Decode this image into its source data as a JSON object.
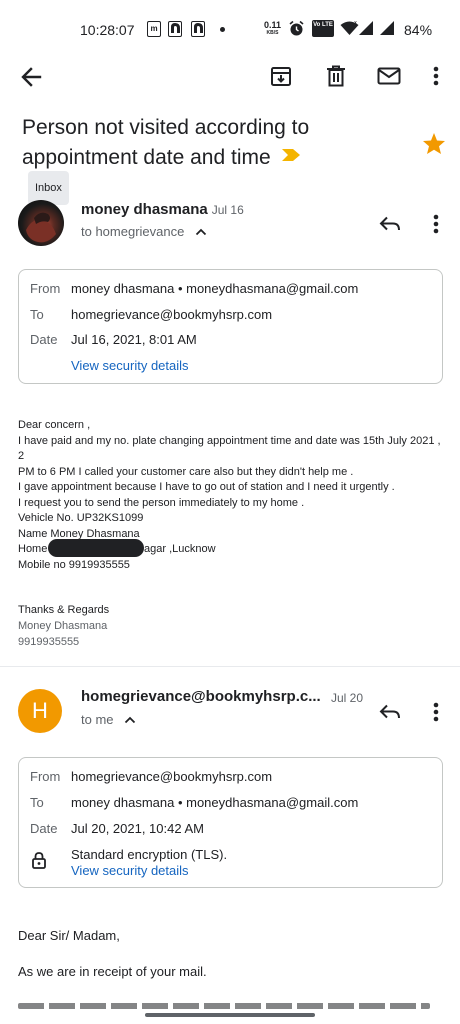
{
  "status_bar": {
    "time": "10:28:07",
    "speed_value": "0.11",
    "speed_unit": "KB/S",
    "volte_label": "Vo LTE",
    "battery": "84%",
    "notification_icons": [
      "m-icon",
      "app-icon",
      "app-icon",
      "dot-icon"
    ]
  },
  "toolbar": {
    "back_icon": "back-arrow-icon",
    "archive_icon": "archive-icon",
    "delete_icon": "trash-icon",
    "mark_unread_icon": "mail-icon",
    "more_icon": "more-vert-icon"
  },
  "subject": {
    "title": "Person not visited according to appointment date and time",
    "label": "Inbox",
    "starred": true,
    "star_color": "#f29900",
    "importance_color": "#f4b400"
  },
  "message1": {
    "sender": "money dhasmana",
    "date": "Jul 16",
    "to_line": "to homegrievance",
    "details": {
      "from_label": "From",
      "from_value": "money dhasmana • moneydhasmana@gmail.com",
      "to_label": "To",
      "to_value": "homegrievance@bookmyhsrp.com",
      "date_label": "Date",
      "date_value": "Jul 16, 2021, 8:01 AM",
      "security_link": "View security details"
    },
    "body": [
      "Dear concern ,",
      "I have paid and my no. plate changing appointment time and date was 15th July 2021 , 2",
      "PM to 6 PM I called your customer care also but they didn't help me .",
      "I gave appointment because I have to go out of station and I need it urgently .",
      "I request you to send the person immediately to my home ."
    ],
    "vehicle": "Vehicle No. UP32KS1099",
    "name": "Name Money Dhasmana",
    "home_prefix": "Home",
    "home_suffix": "agar ,Lucknow",
    "mobile": "Mobile no 9919935555",
    "thanks": "Thanks & Regards",
    "sig_name": "Money Dhasmana",
    "sig_phone": "9919935555"
  },
  "message2": {
    "avatar_letter": "H",
    "avatar_color": "#f29900",
    "sender": "homegrievance@bookmyhsrp.c...",
    "date": "Jul 20",
    "to_line": "to me",
    "details": {
      "from_label": "From",
      "from_value": "homegrievance@bookmyhsrp.com",
      "to_label": "To",
      "to_value": "money dhasmana • moneydhasmana@gmail.com",
      "date_label": "Date",
      "date_value": "Jul 20, 2021, 10:42 AM",
      "encryption": "Standard encryption (TLS).",
      "security_link": "View security details"
    },
    "body_greeting": "Dear Sir/ Madam,",
    "body_line1": "As we are in receipt of your mail."
  }
}
